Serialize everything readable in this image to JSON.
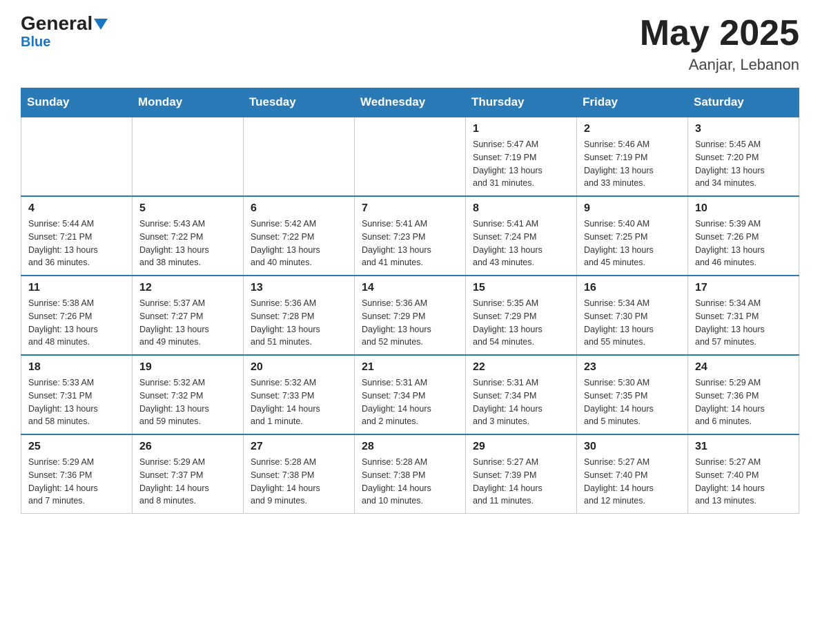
{
  "header": {
    "logo": {
      "general": "General",
      "triangle": "",
      "blue": "Blue"
    },
    "month_year": "May 2025",
    "location": "Aanjar, Lebanon"
  },
  "calendar": {
    "weekdays": [
      "Sunday",
      "Monday",
      "Tuesday",
      "Wednesday",
      "Thursday",
      "Friday",
      "Saturday"
    ],
    "weeks": [
      [
        {
          "day": "",
          "info": ""
        },
        {
          "day": "",
          "info": ""
        },
        {
          "day": "",
          "info": ""
        },
        {
          "day": "",
          "info": ""
        },
        {
          "day": "1",
          "info": "Sunrise: 5:47 AM\nSunset: 7:19 PM\nDaylight: 13 hours\nand 31 minutes."
        },
        {
          "day": "2",
          "info": "Sunrise: 5:46 AM\nSunset: 7:19 PM\nDaylight: 13 hours\nand 33 minutes."
        },
        {
          "day": "3",
          "info": "Sunrise: 5:45 AM\nSunset: 7:20 PM\nDaylight: 13 hours\nand 34 minutes."
        }
      ],
      [
        {
          "day": "4",
          "info": "Sunrise: 5:44 AM\nSunset: 7:21 PM\nDaylight: 13 hours\nand 36 minutes."
        },
        {
          "day": "5",
          "info": "Sunrise: 5:43 AM\nSunset: 7:22 PM\nDaylight: 13 hours\nand 38 minutes."
        },
        {
          "day": "6",
          "info": "Sunrise: 5:42 AM\nSunset: 7:22 PM\nDaylight: 13 hours\nand 40 minutes."
        },
        {
          "day": "7",
          "info": "Sunrise: 5:41 AM\nSunset: 7:23 PM\nDaylight: 13 hours\nand 41 minutes."
        },
        {
          "day": "8",
          "info": "Sunrise: 5:41 AM\nSunset: 7:24 PM\nDaylight: 13 hours\nand 43 minutes."
        },
        {
          "day": "9",
          "info": "Sunrise: 5:40 AM\nSunset: 7:25 PM\nDaylight: 13 hours\nand 45 minutes."
        },
        {
          "day": "10",
          "info": "Sunrise: 5:39 AM\nSunset: 7:26 PM\nDaylight: 13 hours\nand 46 minutes."
        }
      ],
      [
        {
          "day": "11",
          "info": "Sunrise: 5:38 AM\nSunset: 7:26 PM\nDaylight: 13 hours\nand 48 minutes."
        },
        {
          "day": "12",
          "info": "Sunrise: 5:37 AM\nSunset: 7:27 PM\nDaylight: 13 hours\nand 49 minutes."
        },
        {
          "day": "13",
          "info": "Sunrise: 5:36 AM\nSunset: 7:28 PM\nDaylight: 13 hours\nand 51 minutes."
        },
        {
          "day": "14",
          "info": "Sunrise: 5:36 AM\nSunset: 7:29 PM\nDaylight: 13 hours\nand 52 minutes."
        },
        {
          "day": "15",
          "info": "Sunrise: 5:35 AM\nSunset: 7:29 PM\nDaylight: 13 hours\nand 54 minutes."
        },
        {
          "day": "16",
          "info": "Sunrise: 5:34 AM\nSunset: 7:30 PM\nDaylight: 13 hours\nand 55 minutes."
        },
        {
          "day": "17",
          "info": "Sunrise: 5:34 AM\nSunset: 7:31 PM\nDaylight: 13 hours\nand 57 minutes."
        }
      ],
      [
        {
          "day": "18",
          "info": "Sunrise: 5:33 AM\nSunset: 7:31 PM\nDaylight: 13 hours\nand 58 minutes."
        },
        {
          "day": "19",
          "info": "Sunrise: 5:32 AM\nSunset: 7:32 PM\nDaylight: 13 hours\nand 59 minutes."
        },
        {
          "day": "20",
          "info": "Sunrise: 5:32 AM\nSunset: 7:33 PM\nDaylight: 14 hours\nand 1 minute."
        },
        {
          "day": "21",
          "info": "Sunrise: 5:31 AM\nSunset: 7:34 PM\nDaylight: 14 hours\nand 2 minutes."
        },
        {
          "day": "22",
          "info": "Sunrise: 5:31 AM\nSunset: 7:34 PM\nDaylight: 14 hours\nand 3 minutes."
        },
        {
          "day": "23",
          "info": "Sunrise: 5:30 AM\nSunset: 7:35 PM\nDaylight: 14 hours\nand 5 minutes."
        },
        {
          "day": "24",
          "info": "Sunrise: 5:29 AM\nSunset: 7:36 PM\nDaylight: 14 hours\nand 6 minutes."
        }
      ],
      [
        {
          "day": "25",
          "info": "Sunrise: 5:29 AM\nSunset: 7:36 PM\nDaylight: 14 hours\nand 7 minutes."
        },
        {
          "day": "26",
          "info": "Sunrise: 5:29 AM\nSunset: 7:37 PM\nDaylight: 14 hours\nand 8 minutes."
        },
        {
          "day": "27",
          "info": "Sunrise: 5:28 AM\nSunset: 7:38 PM\nDaylight: 14 hours\nand 9 minutes."
        },
        {
          "day": "28",
          "info": "Sunrise: 5:28 AM\nSunset: 7:38 PM\nDaylight: 14 hours\nand 10 minutes."
        },
        {
          "day": "29",
          "info": "Sunrise: 5:27 AM\nSunset: 7:39 PM\nDaylight: 14 hours\nand 11 minutes."
        },
        {
          "day": "30",
          "info": "Sunrise: 5:27 AM\nSunset: 7:40 PM\nDaylight: 14 hours\nand 12 minutes."
        },
        {
          "day": "31",
          "info": "Sunrise: 5:27 AM\nSunset: 7:40 PM\nDaylight: 14 hours\nand 13 minutes."
        }
      ]
    ]
  }
}
